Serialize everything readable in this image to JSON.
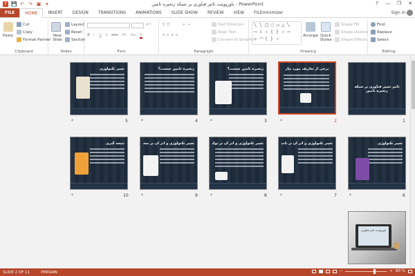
{
  "window": {
    "title": "پاورپوینت تاثیر فناوری بر شبکه زنجیره تامین - PowerPoint",
    "help": "?",
    "minimize": "—",
    "restore": "❐",
    "close": "✕"
  },
  "qat": {
    "save": "💾",
    "undo": "↶",
    "redo": "↷",
    "present": "▣",
    "more": "▾"
  },
  "tabs": [
    "FILE",
    "HOME",
    "INSERT",
    "DESIGN",
    "TRANSITIONS",
    "ANIMATIONS",
    "SLIDE SHOW",
    "REVIEW",
    "VIEW",
    "FILEminimizer"
  ],
  "account": {
    "signin": "Sign in"
  },
  "ribbon": {
    "clipboard": {
      "paste": "Paste",
      "cut": "Cut",
      "copy": "Copy",
      "format_painter": "Format Painter",
      "label": "Clipboard"
    },
    "slides": {
      "new_slide": "New Slide",
      "layout": "Layout",
      "reset": "Reset",
      "section": "Section",
      "label": "Slides"
    },
    "font": {
      "label": "Font",
      "bold": "B",
      "italic": "I",
      "underline": "U",
      "shadow": "S",
      "strike": "abc",
      "spacing": "AV",
      "case": "Aa",
      "color": "A"
    },
    "paragraph": {
      "text_direction": "Text Direction",
      "align_text": "Align Text",
      "convert_smartart": "Convert to SmartArt",
      "label": "Paragraph"
    },
    "drawing": {
      "arrange": "Arrange",
      "quick_styles": "Quick Styles",
      "shape_fill": "Shape Fill",
      "shape_outline": "Shape Outline",
      "shape_effects": "Shape Effects",
      "label": "Drawing"
    },
    "editing": {
      "find": "Find",
      "replace": "Replace",
      "select": "Select",
      "label": "Editing"
    }
  },
  "slides": [
    {
      "num": "1",
      "title": "تاثیر تغییر فناوری بر شبکه زنجیره تامین"
    },
    {
      "num": "2",
      "title": "برخی از تعاریف مورد نیاز"
    },
    {
      "num": "3",
      "title": "زنجیره تامین چیست؟"
    },
    {
      "num": "4",
      "title": "زنجیره تامین چیست؟"
    },
    {
      "num": "5",
      "title": "تغییر تکنولوژی"
    },
    {
      "num": "6",
      "title": "تغییر تکنولوژی"
    },
    {
      "num": "7",
      "title": "تغییر تکنولوژی و اثر آن بر تامین کنندگان"
    },
    {
      "num": "8",
      "title": "تغییر تکنولوژی و اثر آن بر تولیدکنندگان"
    },
    {
      "num": "9",
      "title": "تغییر تکنولوژی و اثر آن بر مشتریان"
    },
    {
      "num": "10",
      "title": "نتیجه گیری"
    },
    {
      "num": "11",
      "title": "پاورپوینت تاثیر فناوری"
    }
  ],
  "star_glyph": "*",
  "status": {
    "slide_info": "SLIDE 2 OF 11",
    "language": "PERSIAN",
    "zoom": "80 %",
    "zoom_fraction": 0.7
  }
}
